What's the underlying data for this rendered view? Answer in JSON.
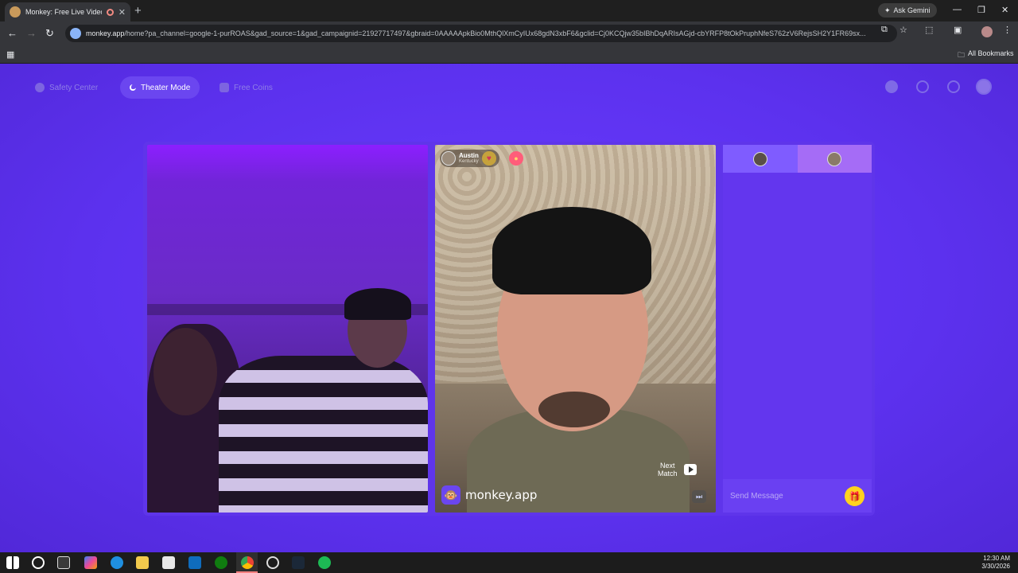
{
  "browser": {
    "tab_title": "Monkey: Free Live Video Ch",
    "new_tab_symbol": "+",
    "gemini_label": "Ask Gemini",
    "url_host": "monkey.app",
    "url_rest": "/home?pa_channel=google-1-purROAS&gad_source=1&gad_campaignid=21927717497&gbraid=0AAAAApkBio0MthQlXmCyIUx68gdN3xbF6&gclid=Cj0KCQjw35bIBhDqARIsAGjd-cbYRFP8tOkPruphNfeS762zV6RejsSH2Y1FR69sx...",
    "all_bookmarks": "All Bookmarks"
  },
  "nav": {
    "safety_center": "Safety Center",
    "theater_mode": "Theater Mode",
    "free_coins": "Free Coins"
  },
  "match": {
    "name": "Austin",
    "location": "Kentucky",
    "next_match_label_1": "Next",
    "next_match_label_2": "Match",
    "brand": "monkey.app"
  },
  "chat": {
    "placeholder": "Send Message"
  },
  "taskbar": {
    "time": "12:30 AM",
    "date": "3/30/2026"
  },
  "colors": {
    "page_bg": "#5c31ee",
    "accent": "#6b46f0",
    "gift": "#ffd21f"
  }
}
